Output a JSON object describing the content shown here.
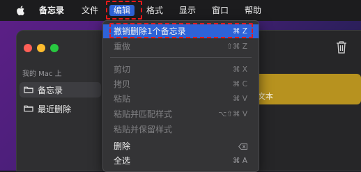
{
  "menubar": {
    "app_name": "备忘录",
    "items": [
      "文件",
      "编辑",
      "格式",
      "显示",
      "窗口",
      "帮助"
    ],
    "active_item": "编辑"
  },
  "sidebar": {
    "section_label": "我的 Mac 上",
    "folders": [
      {
        "label": "备忘录",
        "selected": true
      },
      {
        "label": "最近删除",
        "selected": false
      }
    ]
  },
  "note_preview_text": "文本",
  "edit_menu": {
    "items": [
      {
        "label": "撤销删除1个备忘录",
        "shortcut": "⌘ Z",
        "enabled": true
      },
      {
        "label": "重做",
        "shortcut": "⇧⌘ Z",
        "enabled": false
      },
      {
        "label": "剪切",
        "shortcut": "⌘ X",
        "enabled": false
      },
      {
        "label": "拷贝",
        "shortcut": "⌘ C",
        "enabled": false
      },
      {
        "label": "粘贴",
        "shortcut": "⌘ V",
        "enabled": false
      },
      {
        "label": "粘贴并匹配样式",
        "shortcut": "⌥⇧⌘ V",
        "enabled": false
      },
      {
        "label": "粘贴并保留样式",
        "shortcut": "",
        "enabled": false
      },
      {
        "label": "删除",
        "shortcut": "⌫",
        "enabled": true
      },
      {
        "label": "全选",
        "shortcut": "⌘ A",
        "enabled": true
      }
    ]
  },
  "colors": {
    "menu_highlight": "#2e63d8",
    "annotation_red": "#e8191a",
    "note_yellow": "#b7921f"
  }
}
